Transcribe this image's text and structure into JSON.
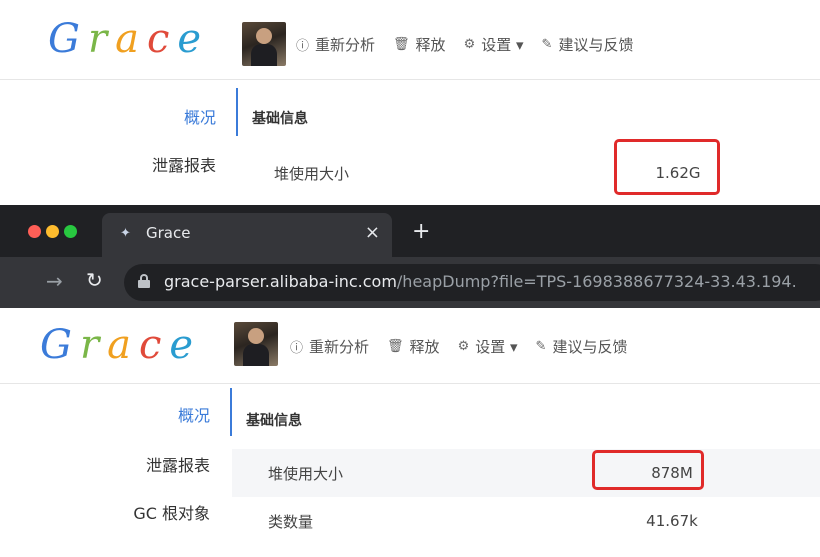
{
  "app": {
    "logo_letters": [
      "G",
      "r",
      "a",
      "c",
      "e"
    ],
    "toolbar": [
      {
        "icon": "info-icon",
        "glyph": "ⓘ",
        "label": "重新分析"
      },
      {
        "icon": "trash-icon",
        "glyph": "🗑",
        "label": "释放"
      },
      {
        "icon": "gear-icon",
        "glyph": "⚙",
        "label": "设置 ▾"
      },
      {
        "icon": "pen-icon",
        "glyph": "✎",
        "label": "建议与反馈"
      }
    ],
    "sidebar": [
      "概况",
      "泄露报表",
      "GC 根对象"
    ],
    "section_title": "基础信息"
  },
  "top_panel": {
    "rows": [
      {
        "label": "堆使用大小",
        "value": "1.62G"
      }
    ]
  },
  "bottom_panel": {
    "rows": [
      {
        "label": "堆使用大小",
        "value": "878M"
      },
      {
        "label": "类数量",
        "value": "41.67k"
      }
    ]
  },
  "browser": {
    "tab_title": "Grace",
    "url_host": "grace-parser.alibaba-inc.com",
    "url_path": "/heapDump?file=TPS-1698388677324-33.43.194."
  },
  "colors": {
    "accent": "#3b7bd9",
    "highlight": "#e02a2a",
    "dot_red": "#ff5f57",
    "dot_yellow": "#febc2e",
    "dot_green": "#28c840"
  }
}
